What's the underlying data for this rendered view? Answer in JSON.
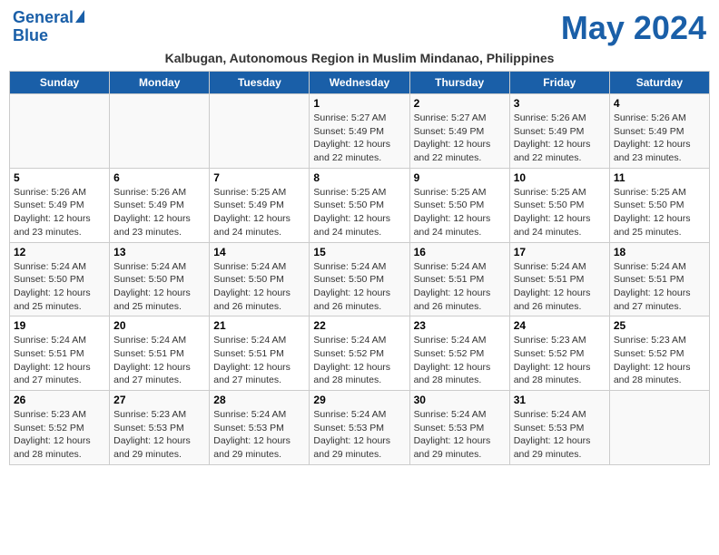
{
  "header": {
    "logo_line1": "General",
    "logo_line2": "Blue",
    "month_title": "May 2024",
    "subtitle": "Kalbugan, Autonomous Region in Muslim Mindanao, Philippines"
  },
  "weekdays": [
    "Sunday",
    "Monday",
    "Tuesday",
    "Wednesday",
    "Thursday",
    "Friday",
    "Saturday"
  ],
  "weeks": [
    [
      {
        "day": "",
        "sunrise": "",
        "sunset": "",
        "daylight": ""
      },
      {
        "day": "",
        "sunrise": "",
        "sunset": "",
        "daylight": ""
      },
      {
        "day": "",
        "sunrise": "",
        "sunset": "",
        "daylight": ""
      },
      {
        "day": "1",
        "sunrise": "Sunrise: 5:27 AM",
        "sunset": "Sunset: 5:49 PM",
        "daylight": "Daylight: 12 hours and 22 minutes."
      },
      {
        "day": "2",
        "sunrise": "Sunrise: 5:27 AM",
        "sunset": "Sunset: 5:49 PM",
        "daylight": "Daylight: 12 hours and 22 minutes."
      },
      {
        "day": "3",
        "sunrise": "Sunrise: 5:26 AM",
        "sunset": "Sunset: 5:49 PM",
        "daylight": "Daylight: 12 hours and 22 minutes."
      },
      {
        "day": "4",
        "sunrise": "Sunrise: 5:26 AM",
        "sunset": "Sunset: 5:49 PM",
        "daylight": "Daylight: 12 hours and 23 minutes."
      }
    ],
    [
      {
        "day": "5",
        "sunrise": "Sunrise: 5:26 AM",
        "sunset": "Sunset: 5:49 PM",
        "daylight": "Daylight: 12 hours and 23 minutes."
      },
      {
        "day": "6",
        "sunrise": "Sunrise: 5:26 AM",
        "sunset": "Sunset: 5:49 PM",
        "daylight": "Daylight: 12 hours and 23 minutes."
      },
      {
        "day": "7",
        "sunrise": "Sunrise: 5:25 AM",
        "sunset": "Sunset: 5:49 PM",
        "daylight": "Daylight: 12 hours and 24 minutes."
      },
      {
        "day": "8",
        "sunrise": "Sunrise: 5:25 AM",
        "sunset": "Sunset: 5:50 PM",
        "daylight": "Daylight: 12 hours and 24 minutes."
      },
      {
        "day": "9",
        "sunrise": "Sunrise: 5:25 AM",
        "sunset": "Sunset: 5:50 PM",
        "daylight": "Daylight: 12 hours and 24 minutes."
      },
      {
        "day": "10",
        "sunrise": "Sunrise: 5:25 AM",
        "sunset": "Sunset: 5:50 PM",
        "daylight": "Daylight: 12 hours and 24 minutes."
      },
      {
        "day": "11",
        "sunrise": "Sunrise: 5:25 AM",
        "sunset": "Sunset: 5:50 PM",
        "daylight": "Daylight: 12 hours and 25 minutes."
      }
    ],
    [
      {
        "day": "12",
        "sunrise": "Sunrise: 5:24 AM",
        "sunset": "Sunset: 5:50 PM",
        "daylight": "Daylight: 12 hours and 25 minutes."
      },
      {
        "day": "13",
        "sunrise": "Sunrise: 5:24 AM",
        "sunset": "Sunset: 5:50 PM",
        "daylight": "Daylight: 12 hours and 25 minutes."
      },
      {
        "day": "14",
        "sunrise": "Sunrise: 5:24 AM",
        "sunset": "Sunset: 5:50 PM",
        "daylight": "Daylight: 12 hours and 26 minutes."
      },
      {
        "day": "15",
        "sunrise": "Sunrise: 5:24 AM",
        "sunset": "Sunset: 5:50 PM",
        "daylight": "Daylight: 12 hours and 26 minutes."
      },
      {
        "day": "16",
        "sunrise": "Sunrise: 5:24 AM",
        "sunset": "Sunset: 5:51 PM",
        "daylight": "Daylight: 12 hours and 26 minutes."
      },
      {
        "day": "17",
        "sunrise": "Sunrise: 5:24 AM",
        "sunset": "Sunset: 5:51 PM",
        "daylight": "Daylight: 12 hours and 26 minutes."
      },
      {
        "day": "18",
        "sunrise": "Sunrise: 5:24 AM",
        "sunset": "Sunset: 5:51 PM",
        "daylight": "Daylight: 12 hours and 27 minutes."
      }
    ],
    [
      {
        "day": "19",
        "sunrise": "Sunrise: 5:24 AM",
        "sunset": "Sunset: 5:51 PM",
        "daylight": "Daylight: 12 hours and 27 minutes."
      },
      {
        "day": "20",
        "sunrise": "Sunrise: 5:24 AM",
        "sunset": "Sunset: 5:51 PM",
        "daylight": "Daylight: 12 hours and 27 minutes."
      },
      {
        "day": "21",
        "sunrise": "Sunrise: 5:24 AM",
        "sunset": "Sunset: 5:51 PM",
        "daylight": "Daylight: 12 hours and 27 minutes."
      },
      {
        "day": "22",
        "sunrise": "Sunrise: 5:24 AM",
        "sunset": "Sunset: 5:52 PM",
        "daylight": "Daylight: 12 hours and 28 minutes."
      },
      {
        "day": "23",
        "sunrise": "Sunrise: 5:24 AM",
        "sunset": "Sunset: 5:52 PM",
        "daylight": "Daylight: 12 hours and 28 minutes."
      },
      {
        "day": "24",
        "sunrise": "Sunrise: 5:23 AM",
        "sunset": "Sunset: 5:52 PM",
        "daylight": "Daylight: 12 hours and 28 minutes."
      },
      {
        "day": "25",
        "sunrise": "Sunrise: 5:23 AM",
        "sunset": "Sunset: 5:52 PM",
        "daylight": "Daylight: 12 hours and 28 minutes."
      }
    ],
    [
      {
        "day": "26",
        "sunrise": "Sunrise: 5:23 AM",
        "sunset": "Sunset: 5:52 PM",
        "daylight": "Daylight: 12 hours and 28 minutes."
      },
      {
        "day": "27",
        "sunrise": "Sunrise: 5:23 AM",
        "sunset": "Sunset: 5:53 PM",
        "daylight": "Daylight: 12 hours and 29 minutes."
      },
      {
        "day": "28",
        "sunrise": "Sunrise: 5:24 AM",
        "sunset": "Sunset: 5:53 PM",
        "daylight": "Daylight: 12 hours and 29 minutes."
      },
      {
        "day": "29",
        "sunrise": "Sunrise: 5:24 AM",
        "sunset": "Sunset: 5:53 PM",
        "daylight": "Daylight: 12 hours and 29 minutes."
      },
      {
        "day": "30",
        "sunrise": "Sunrise: 5:24 AM",
        "sunset": "Sunset: 5:53 PM",
        "daylight": "Daylight: 12 hours and 29 minutes."
      },
      {
        "day": "31",
        "sunrise": "Sunrise: 5:24 AM",
        "sunset": "Sunset: 5:53 PM",
        "daylight": "Daylight: 12 hours and 29 minutes."
      },
      {
        "day": "",
        "sunrise": "",
        "sunset": "",
        "daylight": ""
      }
    ]
  ]
}
